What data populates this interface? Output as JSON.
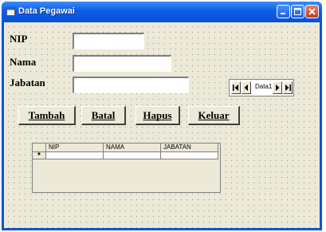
{
  "window": {
    "title": "Data Pegawai"
  },
  "form": {
    "nip_label": "NIP",
    "nama_label": "Nama",
    "jabatan_label": "Jabatan",
    "nip_value": "",
    "nama_value": "",
    "jabatan_value": ""
  },
  "data_control": {
    "caption": "Data1"
  },
  "buttons": {
    "tambah": "Tambah",
    "batal": "Batal",
    "hapus": "Hapus",
    "keluar": "Keluar"
  },
  "grid": {
    "columns": [
      "NIP",
      "NAMA",
      "JABATAN"
    ],
    "new_row_marker": "*"
  },
  "colors": {
    "titlebar": "#0b5ee8",
    "face": "#ece9d8",
    "close_button": "#c4381c"
  },
  "icons": {
    "app": "form-icon",
    "minimize": "minimize-icon",
    "maximize": "maximize-icon",
    "close": "close-icon"
  }
}
